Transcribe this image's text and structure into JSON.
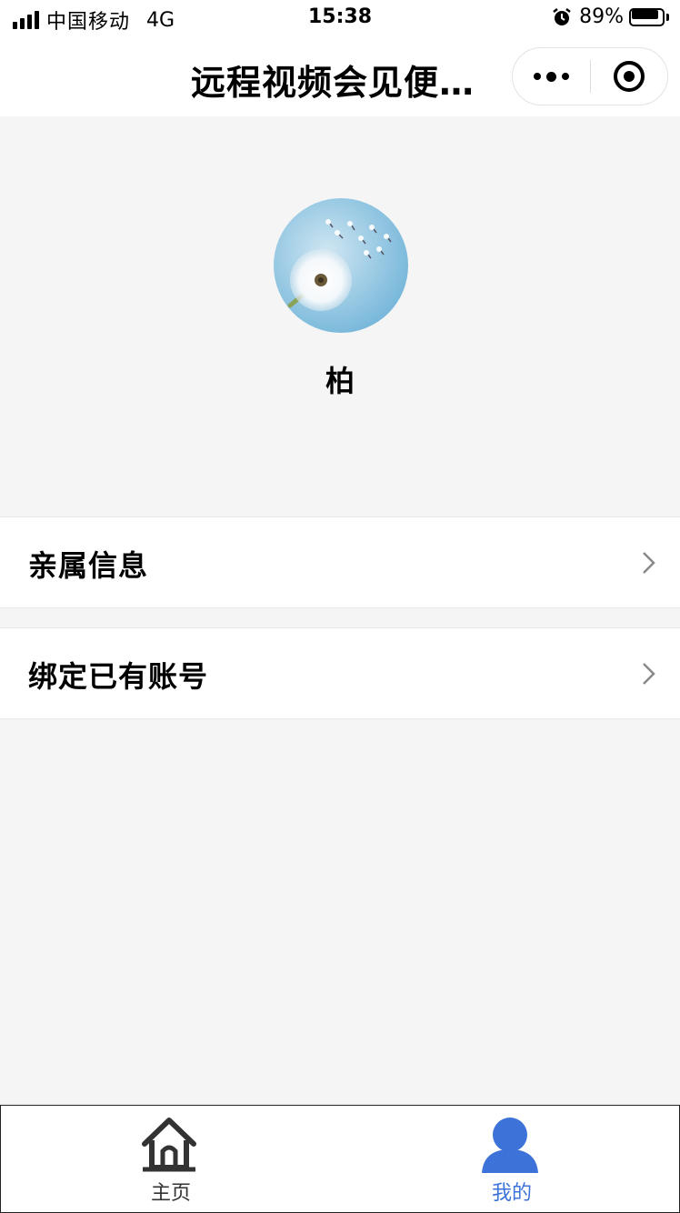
{
  "status_bar": {
    "carrier": "中国移动",
    "network": "4G",
    "time": "15:38",
    "battery_percent": "89%",
    "battery_level": 0.89,
    "icons": [
      "signal-icon",
      "alarm-icon",
      "battery-icon"
    ]
  },
  "nav": {
    "title": "远程视频会见便…",
    "more_icon": "more-icon",
    "close_icon": "close-icon"
  },
  "profile": {
    "avatar": "dandelion-avatar",
    "name": "柏"
  },
  "menu": [
    {
      "label": "亲属信息",
      "icon": "chevron-right-icon"
    },
    {
      "label": "绑定已有账号",
      "icon": "chevron-right-icon"
    }
  ],
  "tab_bar": {
    "tabs": [
      {
        "label": "主页",
        "icon": "home-icon",
        "active": false
      },
      {
        "label": "我的",
        "icon": "user-icon",
        "active": true
      }
    ]
  },
  "colors": {
    "background": "#f5f5f5",
    "surface": "#ffffff",
    "accent": "#3d73d9",
    "text": "#000000",
    "inactive_icon": "#333333",
    "chevron": "#888888"
  }
}
